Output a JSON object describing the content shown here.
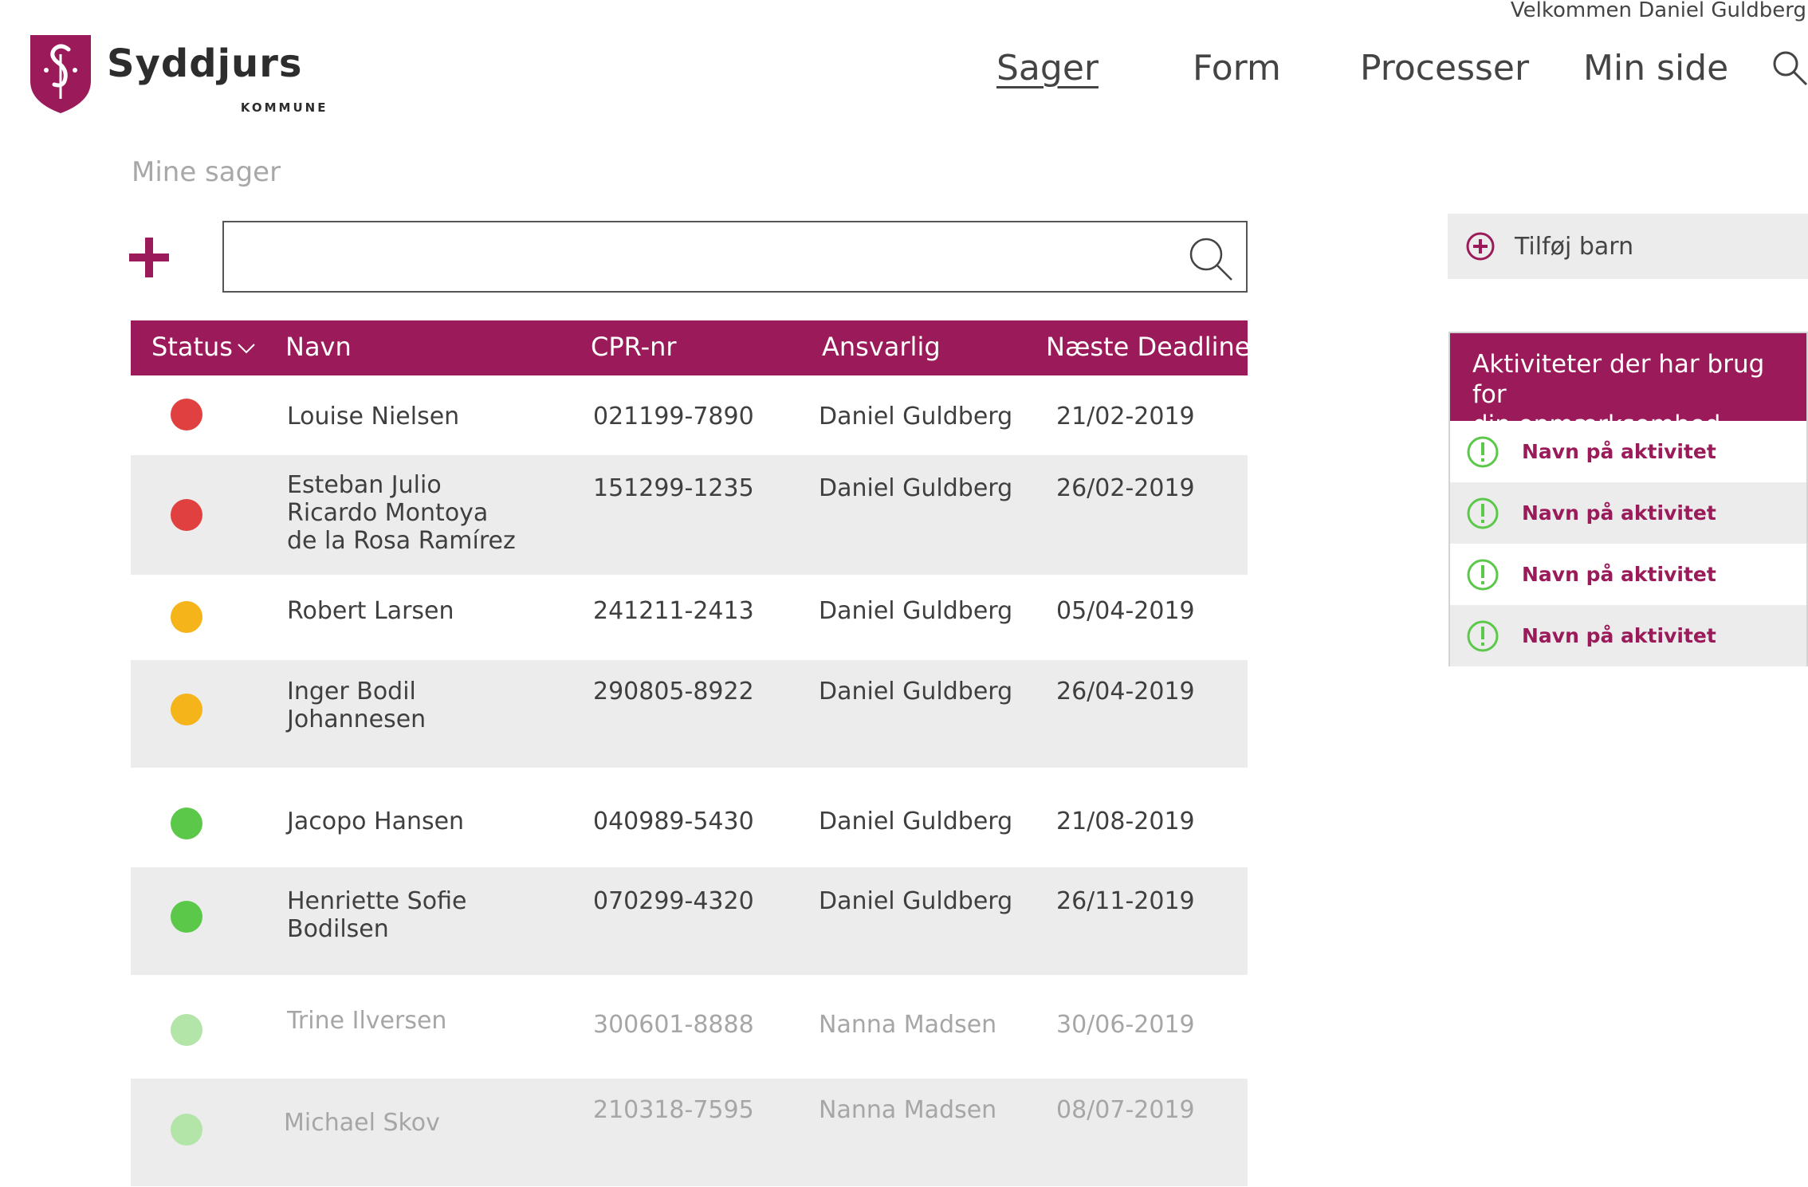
{
  "header": {
    "welcome": "Velkommen Daniel Guldberg",
    "logo": {
      "name": "Syddjurs",
      "sub": "KOMMUNE"
    },
    "nav": [
      {
        "label": "Sager",
        "active": true
      },
      {
        "label": "Form"
      },
      {
        "label": "Processer"
      },
      {
        "label": "Min side"
      }
    ]
  },
  "main": {
    "title": "Mine sager",
    "search": {
      "value": "",
      "placeholder": ""
    },
    "table": {
      "columns": [
        "Status",
        "Navn",
        "CPR-nr",
        "Ansvarlig",
        "Næste Deadline"
      ],
      "rows": [
        {
          "status": "red",
          "name": [
            "Louise Nielsen"
          ],
          "cpr": "021199-7890",
          "responsible": "Daniel Guldberg",
          "deadline": "21/02-2019"
        },
        {
          "status": "red",
          "name": [
            "Esteban Julio",
            "Ricardo Montoya",
            "de la Rosa Ramírez"
          ],
          "cpr": "151299-1235",
          "responsible": "Daniel Guldberg",
          "deadline": "26/02-2019"
        },
        {
          "status": "yellow",
          "name": [
            "Robert Larsen"
          ],
          "cpr": "241211-2413",
          "responsible": "Daniel Guldberg",
          "deadline": "05/04-2019"
        },
        {
          "status": "yellow",
          "name": [
            "Inger Bodil",
            "Johannesen"
          ],
          "cpr": "290805-8922",
          "responsible": "Daniel Guldberg",
          "deadline": "26/04-2019"
        },
        {
          "status": "green",
          "name": [
            "Jacopo Hansen"
          ],
          "cpr": "040989-5430",
          "responsible": "Daniel Guldberg",
          "deadline": "21/08-2019"
        },
        {
          "status": "green",
          "name": [
            "Henriette Sofie",
            "Bodilsen"
          ],
          "cpr": "070299-4320",
          "responsible": "Daniel Guldberg",
          "deadline": "26/11-2019"
        },
        {
          "status": "lightgreen",
          "name": [
            "Trine Ilversen"
          ],
          "cpr": "300601-8888",
          "responsible": "Nanna Madsen",
          "deadline": "30/06-2019"
        },
        {
          "status": "lightgreen",
          "name": [
            "Michael Skov"
          ],
          "cpr": "210318-7595",
          "responsible": "Nanna Madsen",
          "deadline": "08/07-2019"
        }
      ]
    }
  },
  "sidebar": {
    "add_child": "Tilføj barn",
    "activities": {
      "title": [
        "Aktiviteter der har brug for",
        "din opmærksomhed"
      ],
      "items": [
        "Navn på aktivitet",
        "Navn på aktivitet",
        "Navn på aktivitet",
        "Navn på aktivitet"
      ]
    }
  },
  "colors": {
    "brand": "#9b1b5a",
    "red": "#e04040",
    "yellow": "#f4b41a",
    "green": "#5cc84a",
    "lightgreen": "#b3e4a8",
    "activity_icon": "#5cc84a"
  },
  "icons": [
    "shield-logo-icon",
    "search-icon",
    "plus-icon",
    "chevron-down-icon",
    "plus-circle-icon",
    "exclamation-circle-icon"
  ]
}
